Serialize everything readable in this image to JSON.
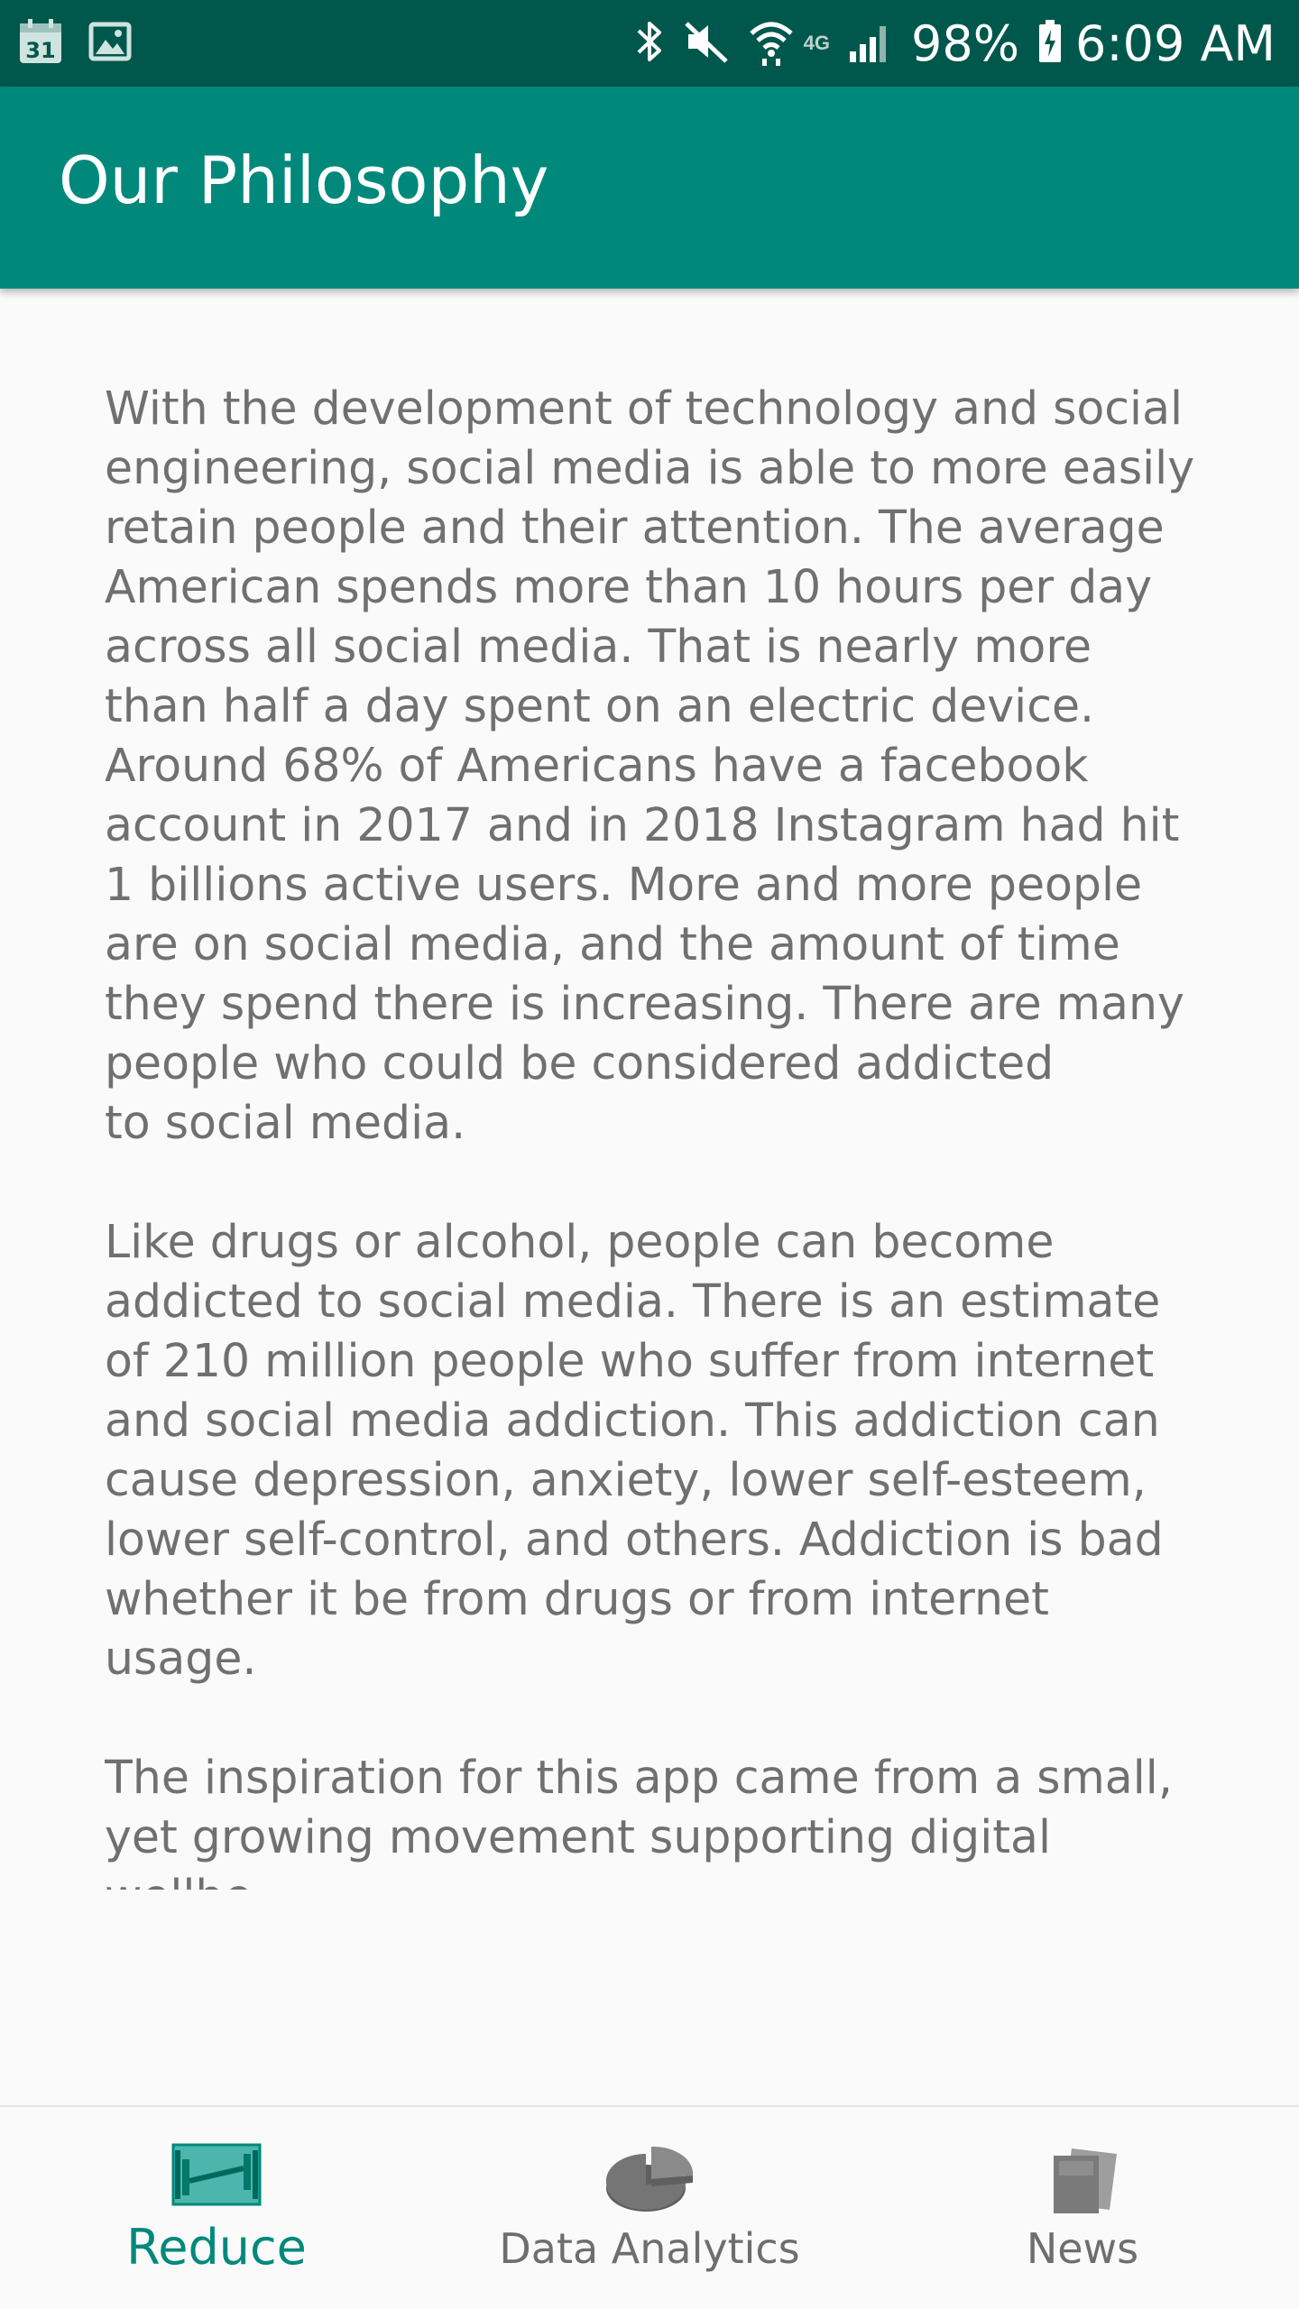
{
  "status_bar": {
    "left_icons": [
      "calendar-icon",
      "gallery-icon"
    ],
    "calendar_day": "31",
    "right_icons": [
      "bluetooth-icon",
      "mute-icon",
      "wifi-icon",
      "signal-icon",
      "battery-icon"
    ],
    "network_label": "4G",
    "battery": "98%",
    "time": "6:09 AM"
  },
  "app_bar": {
    "title": "Our Philosophy"
  },
  "article": {
    "paragraphs": [
      "With the development of technology and social\nengineering, social media is able to more easily\nretain people and their attention.  The average\nAmerican spends more than 10 hours per day\nacross all social media.  That is nearly more\nthan half a day spent on an electric device.\nAround 68% of Americans have a facebook\naccount in 2017 and in 2018 Instagram had hit\n1 billions active users.  More and more people\nare on social media, and the amount of time\nthey spend there is increasing. There are many\npeople who could be considered addicted\nto social media.",
      "Like drugs or alcohol, people can become\naddicted to social media.  There is an estimate\nof 210 million people who suffer from internet\nand social media addiction.  This addiction can\ncause depression, anxiety, lower self-esteem,\nlower self-control, and others.  Addiction is bad\nwhether it be from drugs or from internet usage.",
      "The inspiration for this app came from a small,\nyet growing movement supporting digital wellbe-\ning, or the desire finding a balance between the\nworld and technology. With new apps coming"
    ]
  },
  "bottom_nav": {
    "items": [
      {
        "label": "Reduce",
        "icon": "dumbbell-icon",
        "active": true
      },
      {
        "label": "Data Analytics",
        "icon": "pie-chart-icon",
        "active": false
      },
      {
        "label": "News",
        "icon": "newspaper-icon",
        "active": false
      }
    ]
  },
  "colors": {
    "status_bar": "#00574b",
    "app_bar": "#00897b",
    "accent": "#00897b",
    "body_text": "#707070",
    "inactive_nav": "#6e6e6e"
  }
}
